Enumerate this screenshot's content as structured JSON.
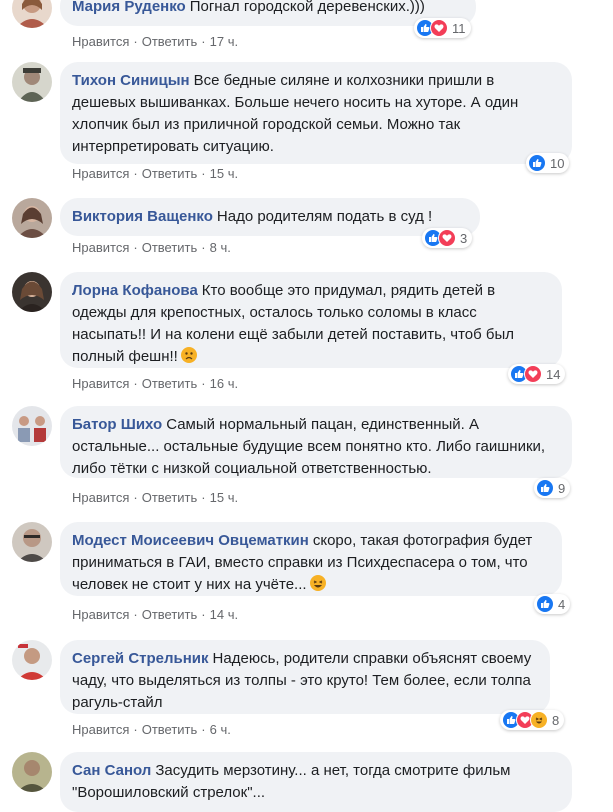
{
  "comments": [
    {
      "author": "Мария Руденко",
      "text": "Погнал городской деревенских.)))",
      "like_label": "Нравится",
      "reply_label": "Ответить",
      "time": "17 ч.",
      "reaction_count": "11",
      "reactions": [
        "like",
        "love"
      ],
      "avatar_color": "#c79a82"
    },
    {
      "author": "Тихон Синицын",
      "text": "Все бедные силяне и колхозники пришли в дешевых вышиванках. Больше нечего носить на хуторе. А один хлопчик был из приличной городской семьи. Можно так интерпретировать ситуацию.",
      "like_label": "Нравится",
      "reply_label": "Ответить",
      "time": "15 ч.",
      "reaction_count": "10",
      "reactions": [
        "like"
      ],
      "avatar_color": "#7a7a6e"
    },
    {
      "author": "Виктория Ващенко",
      "text": "Надо родителям подать в суд !",
      "like_label": "Нравится",
      "reply_label": "Ответить",
      "time": "8 ч.",
      "reaction_count": "3",
      "reactions": [
        "like",
        "love"
      ],
      "avatar_color": "#8c7064"
    },
    {
      "author": "Лорна Кофанова",
      "text": "Кто вообще это придумал, рядить детей в одежды для крепостных, осталось только соломы в класс насыпать!! И на колени ещё забыли детей поставить, чтоб был полный фешн!!",
      "emoji": "sad-face",
      "like_label": "Нравится",
      "reply_label": "Ответить",
      "time": "16 ч.",
      "reaction_count": "14",
      "reactions": [
        "like",
        "love"
      ],
      "avatar_color": "#5a4e44"
    },
    {
      "author": "Батор Шихо",
      "text": "Самый нормальный пацан, единственный. А остальные... остальные будущие всем понятно кто. Либо гаишники, либо тётки с низкой социальной ответственностью.",
      "like_label": "Нравится",
      "reply_label": "Ответить",
      "time": "15 ч.",
      "reaction_count": "9",
      "reactions": [
        "like"
      ],
      "avatar_color": "#b6b9c2"
    },
    {
      "author": "Модест Моисеевич Овцематкин",
      "text": "скоро, такая фотография будет приниматься в ГАИ, вместо справки из Психдеспасера о том, что человек не стоит у них на учёте...",
      "emoji": "laughing-face",
      "like_label": "Нравится",
      "reply_label": "Ответить",
      "time": "14 ч.",
      "reaction_count": "4",
      "reactions": [
        "like"
      ],
      "avatar_color": "#a08a7a"
    },
    {
      "author": "Сергей Стрельник",
      "text": "Надеюсь, родители справки объяснят своему чаду, что выделяться из толпы - это круто! Тем более, если толпа рагуль-стайл",
      "like_label": "Нравится",
      "reply_label": "Ответить",
      "time": "6 ч.",
      "reaction_count": "8",
      "reactions": [
        "like",
        "love",
        "haha"
      ],
      "avatar_color": "#d0d4d8"
    },
    {
      "author": "Сан Санол",
      "text": "Засудить мерзотину... а нет, тогда смотрите фильм \"Ворошиловский стрелок\"...",
      "avatar_color": "#7c7a5e"
    }
  ],
  "colors": {
    "bubble_bg": "#f0f2f5",
    "author_link": "#385898",
    "meta_text": "#65676b",
    "like_blue": "#1877f2",
    "love_red": "#f33e58",
    "haha_yellow": "#f7b125"
  }
}
